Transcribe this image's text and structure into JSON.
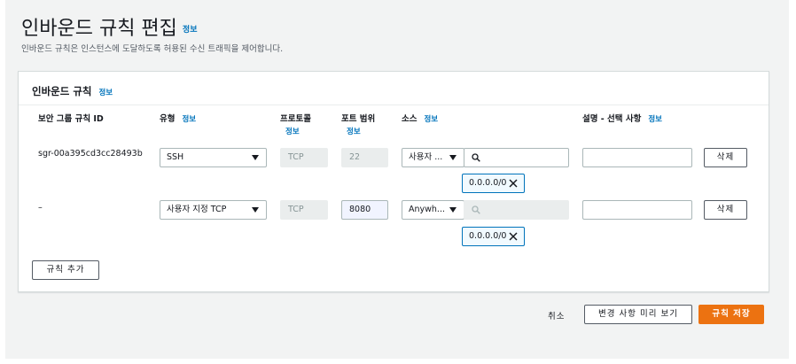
{
  "page": {
    "title": "인바운드 규칙 편집",
    "title_info": "정보",
    "subtitle": "인바운드 규칙은 인스턴스에 도달하도록 허용된 수신 트래픽을 제어합니다."
  },
  "card": {
    "title": "인바운드 규칙",
    "info": "정보"
  },
  "columns": {
    "rule_id": "보안 그룹 규칙 ID",
    "type": "유형",
    "type_info": "정보",
    "protocol": "프로토콜",
    "protocol_info": "정보",
    "port_range": "포트 범위",
    "port_range_info": "정보",
    "source": "소스",
    "source_info": "정보",
    "description": "설명 - 선택 사항",
    "description_info": "정보"
  },
  "rules": [
    {
      "rule_id": "sgr-00a395cd3cc28493b",
      "type": "SSH",
      "protocol": "TCP",
      "port": "22",
      "source_type": "사용자 ...",
      "source_search": "",
      "token": "0.0.0.0/0",
      "description": "",
      "delete_label": "삭제"
    },
    {
      "rule_id": "–",
      "type": "사용자 지정 TCP",
      "protocol": "TCP",
      "port": "8080",
      "source_type": "Anywh...",
      "source_search": "",
      "token": "0.0.0.0/0",
      "description": "",
      "delete_label": "삭제"
    }
  ],
  "add_rule_label": "규칙 추가",
  "footer": {
    "cancel": "취소",
    "preview": "변경 사항 미리 보기",
    "save": "규칙 저장"
  },
  "colors": {
    "link": "#0073bb",
    "primary": "#ec7211",
    "background": "#f2f3f3"
  }
}
